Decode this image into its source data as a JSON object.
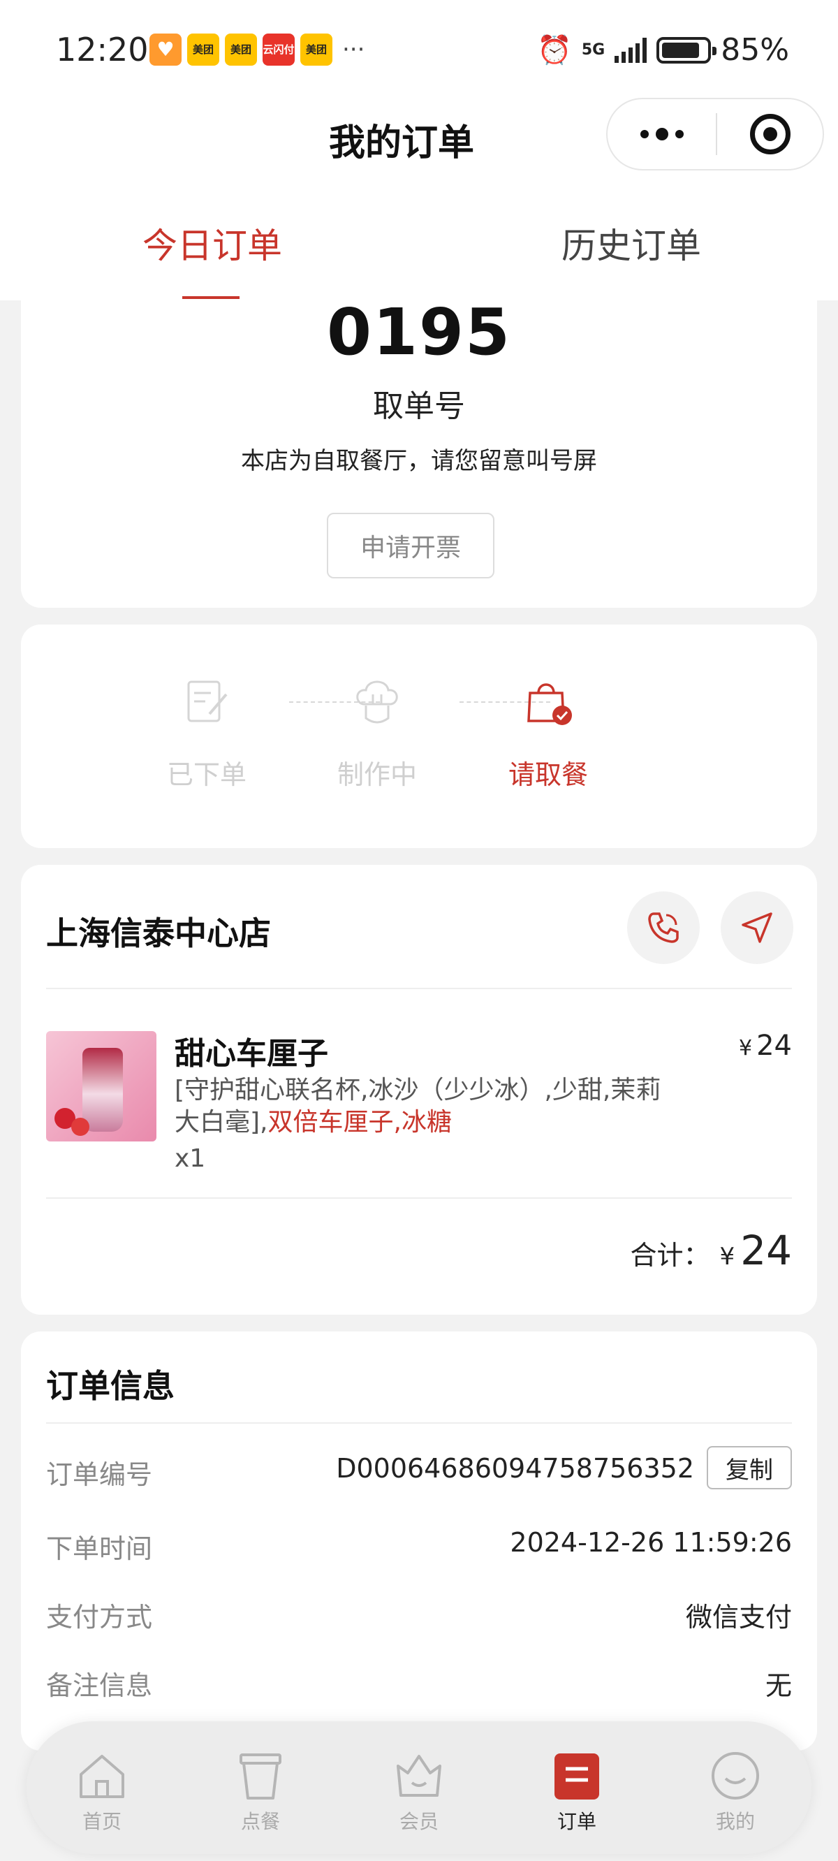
{
  "status_bar": {
    "time": "12:20",
    "app_labels": [
      "美团",
      "美团",
      "云闪付",
      "美团"
    ],
    "network": "5G",
    "battery": "85%",
    "battery_level": 0.85
  },
  "nav": {
    "title": "我的订单"
  },
  "tabs": [
    {
      "label": "今日订单"
    },
    {
      "label": "历史订单"
    }
  ],
  "pickup": {
    "number": "0195",
    "label": "取单号",
    "notice": "本店为自取餐厅，请您留意叫号屏",
    "invoice_button": "申请开票"
  },
  "progress": {
    "steps": [
      {
        "label": "已下单",
        "icon": "order-placed-icon"
      },
      {
        "label": "制作中",
        "icon": "chef-hat-icon"
      },
      {
        "label": "请取餐",
        "icon": "shopping-bag-check-icon"
      }
    ],
    "active_step": 3
  },
  "store": {
    "name": "上海信泰中心店",
    "item": {
      "name": "甜心车厘子",
      "currency": "¥",
      "price": "24",
      "desc_plain": "[守护甜心联名杯,冰沙（少少冰）,少甜,茉莉大白毫],",
      "desc_highlight": "双倍车厘子,冰糖",
      "qty": "x1"
    },
    "total_label": "合计：",
    "total_currency": "¥",
    "total_amount": "24"
  },
  "order_info": {
    "title": "订单信息",
    "rows": [
      {
        "label": "订单编号",
        "value": "D0006468609475875635​2"
      },
      {
        "label": "下单时间",
        "value": "2024-12-26 11:59:26"
      },
      {
        "label": "支付方式",
        "value": "微信支付"
      },
      {
        "label": "备注信息",
        "value": "无"
      }
    ],
    "copy_button": "复制"
  },
  "tabbar": [
    {
      "label": "首页",
      "icon": "home-icon"
    },
    {
      "label": "点餐",
      "icon": "cup-icon"
    },
    {
      "label": "会员",
      "icon": "crown-icon"
    },
    {
      "label": "订单",
      "icon": "order-icon"
    },
    {
      "label": "我的",
      "icon": "smile-icon"
    }
  ],
  "colors": {
    "accent": "#c8352b",
    "inactive": "#cfcfcf",
    "background": "#f2f2f2"
  }
}
